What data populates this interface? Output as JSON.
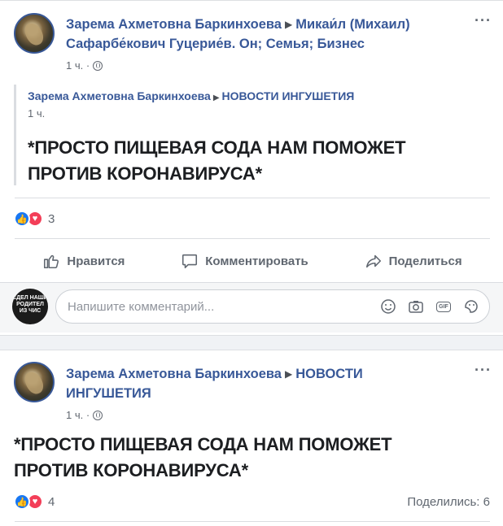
{
  "post1": {
    "author": "Зарема Ахметовна Баркинхоева",
    "target": "Микаи́л (Михаил) Сафарбе́кович Гуцерие́в. Он; Семья; Бизнес",
    "time": "1 ч. ·",
    "more": "···",
    "shared": {
      "author": "Зарема Ахметовна Баркинхоева",
      "target": "НОВОСТИ ИНГУШЕТИЯ",
      "time": "1 ч."
    },
    "text_line1": "*ПРОСТО ПИЩЕВАЯ СОДА НАМ ПОМОЖЕТ",
    "text_line2": "ПРОТИВ КОРОНАВИРУСА*",
    "reaction_count": "3",
    "actions": {
      "like": "Нравится",
      "comment": "Комментировать",
      "share": "Поделиться"
    },
    "comment_placeholder": "Напишите комментарий...",
    "commenter_avatar_text": "СДЕЛ НАШИ РОДИТЕЛ ИЗ ЧИС"
  },
  "post2": {
    "author": "Зарема Ахметовна Баркинхоева",
    "target_line1": "НОВОСТИ",
    "target_line2": "ИНГУШЕТИЯ",
    "time": "1 ч. ·",
    "more": "···",
    "text_line1": "*ПРОСТО ПИЩЕВАЯ СОДА НАМ ПОМОЖЕТ",
    "text_line2": "ПРОТИВ КОРОНАВИРУСА*",
    "reaction_count": "4",
    "shares": "Поделились: 6"
  },
  "colors": {
    "link": "#385898",
    "like": "#1877f2",
    "love": "#f33e58",
    "muted": "#606770"
  },
  "icons": [
    "globe-icon",
    "more-icon",
    "like-reaction-icon",
    "love-reaction-icon",
    "thumbs-up-icon",
    "comment-icon",
    "share-icon",
    "emoji-icon",
    "camera-icon",
    "gif-icon",
    "sticker-icon"
  ]
}
